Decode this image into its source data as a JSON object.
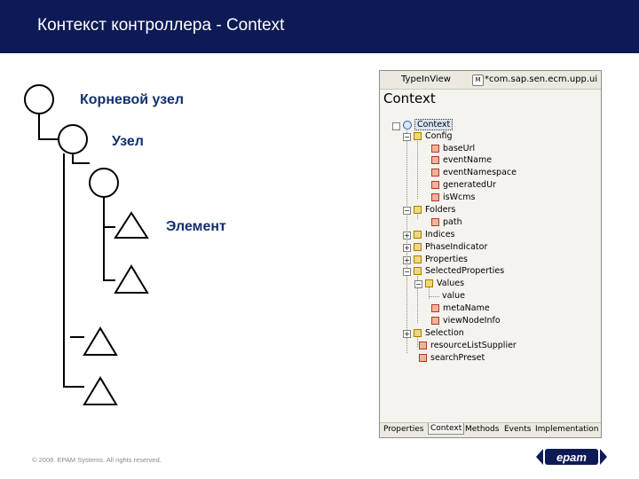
{
  "header": {
    "title": "Контекст контроллера - Context"
  },
  "diagram": {
    "root_label": "Корневой узел",
    "node_label": "Узел",
    "element_label": "Элемент"
  },
  "panel": {
    "tab_view": "TypeInView",
    "tab_module": "*com.sap.sen.ecm.upp.ui",
    "tab_module_badge": "M",
    "heading": "Context",
    "tree": {
      "context": "Context",
      "config": "Config",
      "baseUrl": "baseUrl",
      "eventName": "eventName",
      "eventNamespace": "eventNamespace",
      "generatedUr": "generatedUr",
      "isWcms": "isWcms",
      "folders": "Folders",
      "path": "path",
      "indices": "Indices",
      "phaseIndicator": "PhaseIndicator",
      "properties": "Properties",
      "selectedProperties": "SelectedProperties",
      "values": "Values",
      "value": "value",
      "metaName": "metaName",
      "viewNodeInfo": "viewNodeInfo",
      "selection": "Selection",
      "resourceListSupplier": "resourceListSupplier",
      "searchPreset": "searchPreset"
    },
    "bottom_tabs": [
      "Properties",
      "Context",
      "Methods",
      "Events",
      "Implementation"
    ]
  },
  "footer": {
    "copyright": "© 2008. EPAM Systems. All rights reserved."
  },
  "logo": {
    "text": "epam"
  },
  "colors": {
    "header_bg": "#0d1a55",
    "label_blue": "#12306e"
  }
}
